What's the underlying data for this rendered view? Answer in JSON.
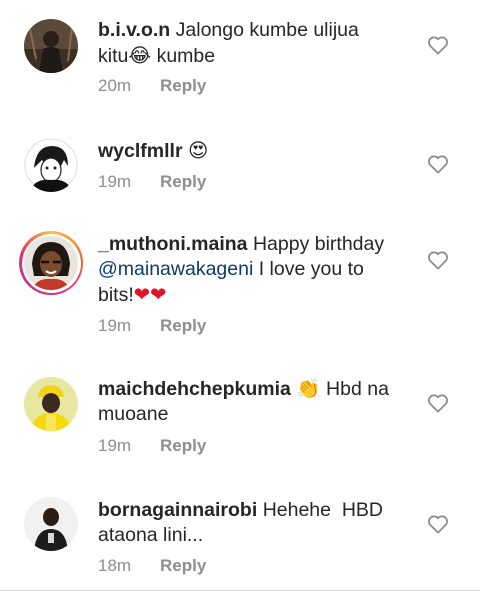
{
  "comments": [
    {
      "username": "b.i.v.o.n",
      "text_parts": [
        "Jalongo kumbe ulijua",
        "kitu",
        "😂",
        "kumbe"
      ],
      "time": "20m",
      "reply_label": "Reply",
      "avatar_icon": "dark-photo-avatar"
    },
    {
      "username": "wyclfmllr",
      "emoji": "😍",
      "time": "19m",
      "reply_label": "Reply",
      "avatar_icon": "anime-drawing-avatar"
    },
    {
      "username": "_muthoni.maina",
      "text_a": "Happy birthday",
      "mention": "@mainawakageni",
      "text_b": "I love you to",
      "text_c": "bits!",
      "hearts": "❤❤",
      "time": "19m",
      "reply_label": "Reply",
      "avatar_icon": "woman-photo-avatar-with-story-ring"
    },
    {
      "username": "maichdehchepkumia",
      "emoji": "👏",
      "text_a": "Hbd na",
      "text_b": "muoane",
      "time": "19m",
      "reply_label": "Reply",
      "avatar_icon": "yellow-outfit-avatar"
    },
    {
      "username": "bornagainnairobi",
      "text_a": "Hehehe  HBD",
      "text_b": "ataona lini...",
      "time": "18m",
      "reply_label": "Reply",
      "avatar_icon": "man-photo-avatar"
    }
  ],
  "colors": {
    "username": "#262626",
    "meta": "#8e8e8e",
    "mention": "#0a3d6b",
    "heart_outline": "#8e8e8e",
    "red_heart": "#e0142c"
  },
  "icons": {
    "like": "heart-outline-icon"
  }
}
